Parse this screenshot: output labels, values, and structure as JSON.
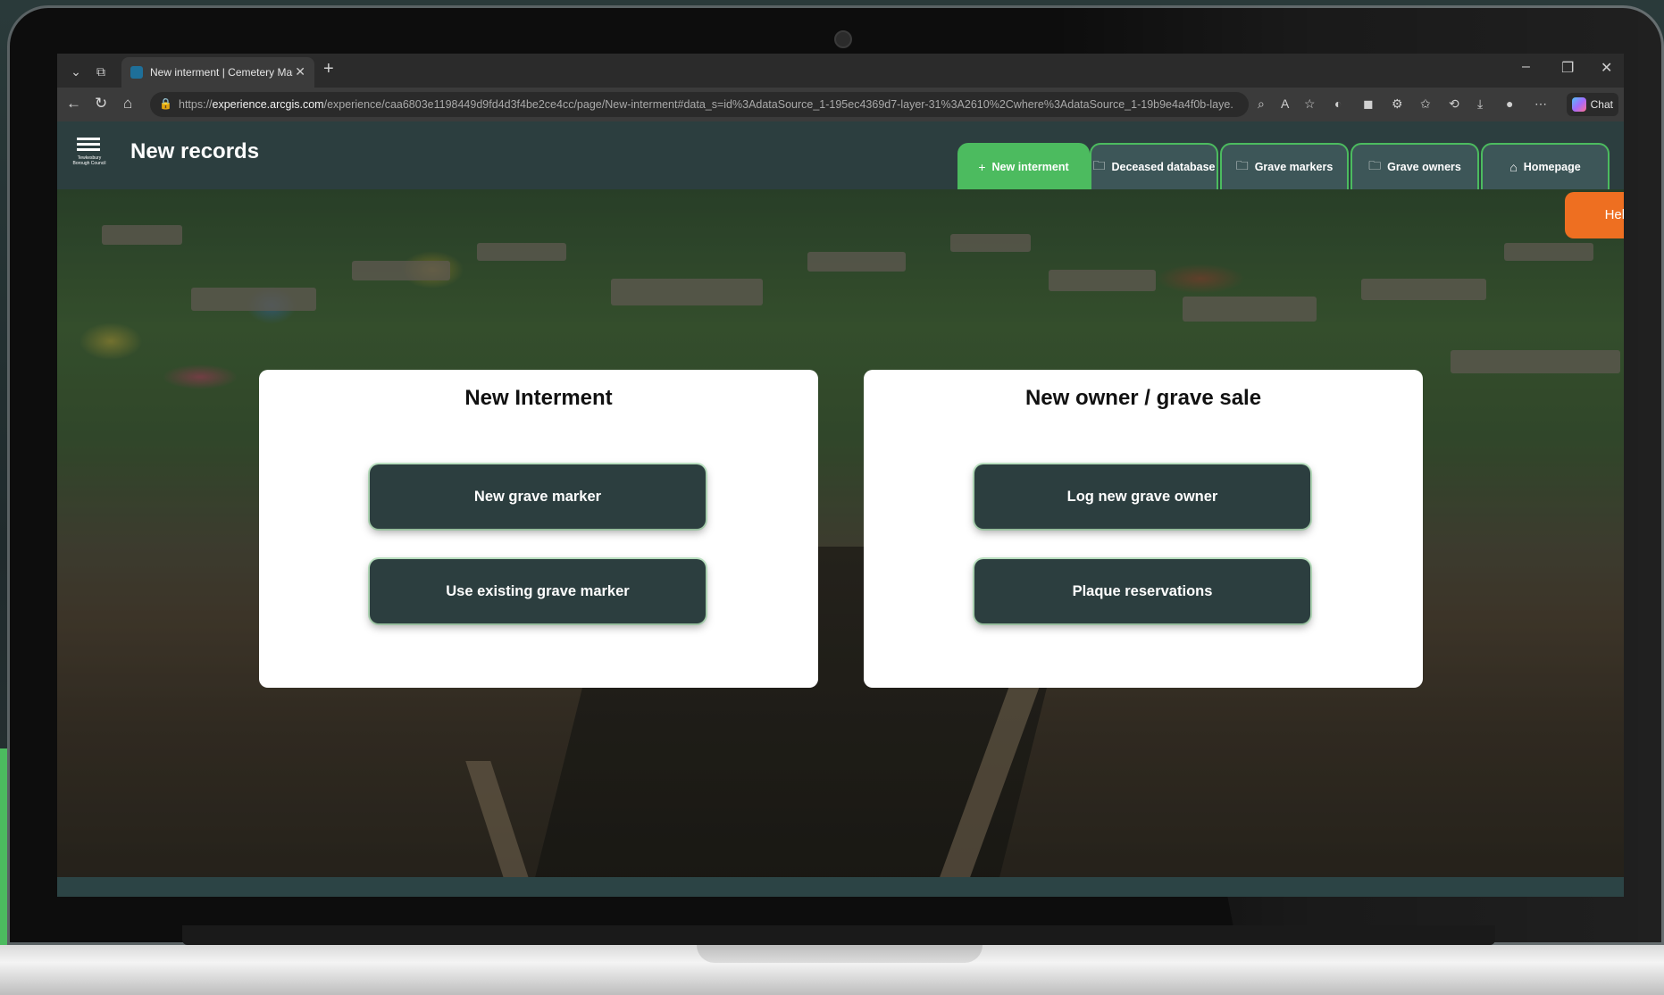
{
  "browser": {
    "tab_title": "New interment | Cemetery Manag",
    "url_prefix": "https://",
    "url_host": "experience.arcgis.com",
    "url_path": "/experience/caa6803e1198449d9fd4d3f4be2ce4cc/page/New-interment#data_s=id%3AdataSource_1-195ec4369d7-layer-31%3A2610%2Cwhere%3AdataSource_1-19b9e4a4f0b-laye...",
    "chat_label": "Chat"
  },
  "header": {
    "logo_caption": "Tewkesbury Borough Council",
    "title": "New records",
    "tabs": [
      {
        "label": "New interment",
        "icon": "plus-icon",
        "active": true
      },
      {
        "label": "Deceased database",
        "icon": "folder-icon",
        "active": false
      },
      {
        "label": "Grave markers",
        "icon": "folder-icon",
        "active": false
      },
      {
        "label": "Grave owners",
        "icon": "folder-icon",
        "active": false
      },
      {
        "label": "Homepage",
        "icon": "home-icon",
        "active": false
      }
    ]
  },
  "help_label": "Help",
  "cards": [
    {
      "title": "New Interment",
      "buttons": [
        "New grave marker",
        "Use existing grave marker"
      ]
    },
    {
      "title": "New owner / grave sale",
      "buttons": [
        "Log new grave owner",
        "Plaque reservations"
      ]
    }
  ],
  "colors": {
    "accent_green": "#4cbb5f",
    "header_teal": "#2c3e3f",
    "help_orange": "#ee6f21"
  }
}
